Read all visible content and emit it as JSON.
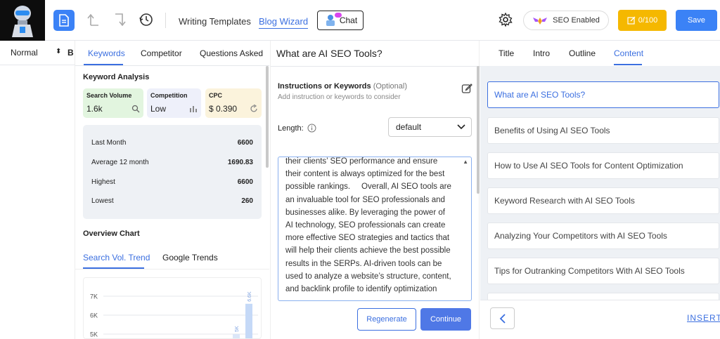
{
  "toolbar": {
    "writing_templates": "Writing Templates",
    "blog_wizard": "Blog Wizard",
    "chat": "Chat",
    "seo_enabled": "SEO Enabled",
    "credits": "0/100",
    "save": "Save"
  },
  "format_bar": {
    "style": "Normal",
    "bold": "B"
  },
  "keywords_panel": {
    "tabs": [
      "Keywords",
      "Competitor",
      "Questions Asked"
    ],
    "active_tab": "Keywords",
    "section_title": "Keyword Analysis",
    "metrics": [
      {
        "label": "Search Volume",
        "value": "1.6k",
        "icon": "search-icon",
        "color": "#e2f5df"
      },
      {
        "label": "Competition",
        "value": "Low",
        "icon": "bar-chart-icon",
        "color": "#eef0fa"
      },
      {
        "label": "CPC",
        "value": "$ 0.390",
        "icon": "refresh-icon",
        "color": "#fbf3dc"
      }
    ],
    "stats": [
      {
        "label": "Last Month",
        "value": "6600"
      },
      {
        "label": "Average 12 month",
        "value": "1690.83"
      },
      {
        "label": "Highest",
        "value": "6600"
      },
      {
        "label": "Lowest",
        "value": "260"
      }
    ],
    "overview_title": "Overview Chart",
    "chart_tabs": [
      "Search Vol. Trend",
      "Google Trends"
    ],
    "active_chart_tab": "Search Vol. Trend"
  },
  "chart_data": {
    "type": "bar",
    "categories": [
      "",
      ""
    ],
    "values": [
      6600,
      5000
    ],
    "data_labels": [
      "6.6K",
      "5K"
    ],
    "y_ticks": [
      "7K",
      "6K",
      "5K"
    ],
    "ylim": [
      4800,
      7200
    ],
    "title": "",
    "xlabel": "",
    "ylabel": ""
  },
  "center": {
    "title": "What are AI SEO Tools?",
    "instructions_label": "Instructions or Keywords",
    "instructions_optional": "(Optional)",
    "instructions_placeholder": "Add instruction or keywords to consider",
    "length_label": "Length:",
    "length_value": "default",
    "content_text": "their clients’ SEO performance and ensure their content is always optimized for the best possible rankings.     Overall, AI SEO tools are an invaluable tool for SEO professionals and businesses alike. By leveraging the power of AI technology, SEO professionals can create more effective SEO strategies and tactics that will help their clients achieve the best possible results in the SERPs. AI-driven tools can be used to analyze a website’s structure, content, and backlink profile to identify optimization",
    "regenerate": "Regenerate",
    "continue": "Continue"
  },
  "right_panel": {
    "tabs": [
      "Title",
      "Intro",
      "Outline",
      "Content"
    ],
    "active_tab": "Content",
    "outline_items": [
      "What are AI SEO Tools?",
      "Benefits of Using AI SEO Tools",
      "How to Use AI SEO Tools for Content Optimization",
      "Keyword Research with AI SEO Tools",
      "Analyzing Your Competitors with AI SEO Tools",
      "Tips for Outranking Competitors With AI SEO Tools"
    ],
    "insert": "INSERT"
  },
  "colors": {
    "accent": "#3b6fe0",
    "save_button": "#3b82f6",
    "credits_button": "#f5b800"
  }
}
